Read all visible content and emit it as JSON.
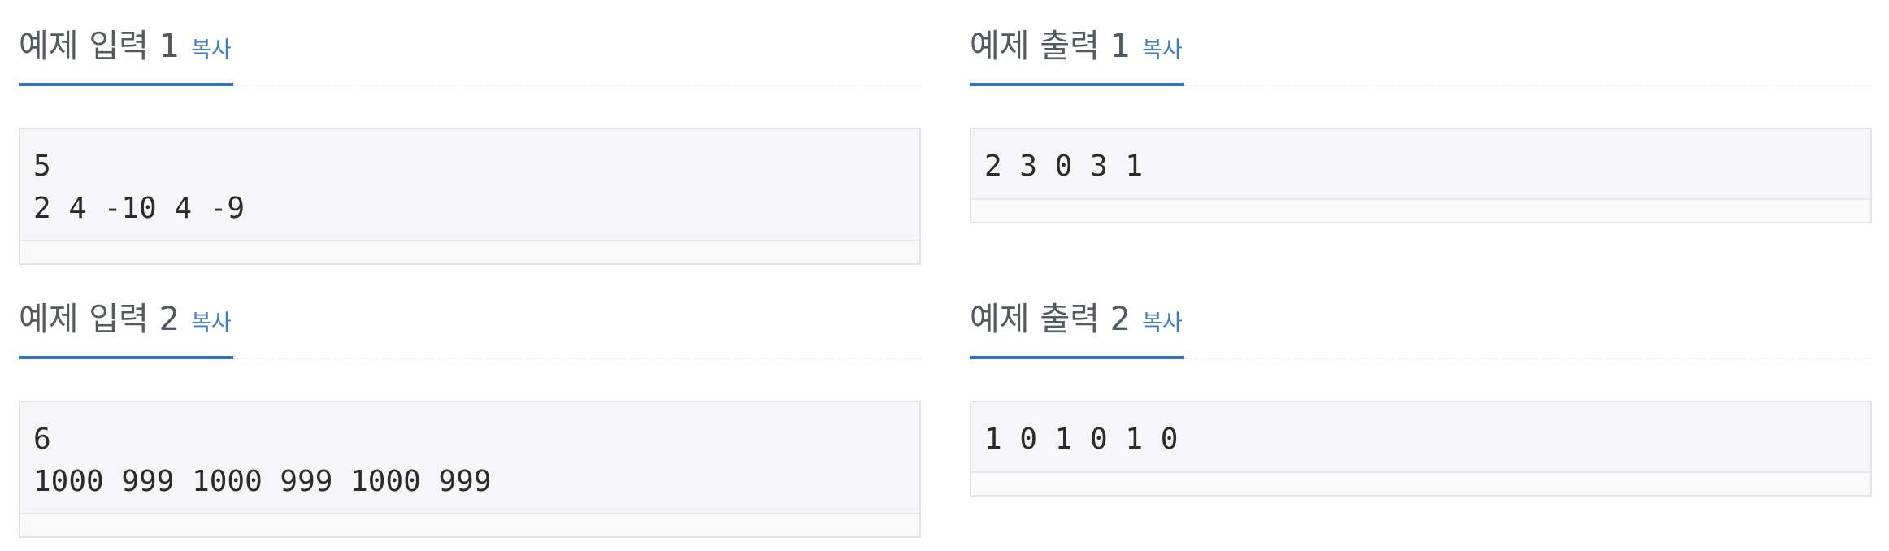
{
  "samples": [
    {
      "title": "예제 입력 1",
      "copy_label": "복사",
      "content": "5\n2 4 -10 4 -9"
    },
    {
      "title": "예제 출력 1",
      "copy_label": "복사",
      "content": "2 3 0 3 1"
    },
    {
      "title": "예제 입력 2",
      "copy_label": "복사",
      "content": "6\n1000 999 1000 999 1000 999"
    },
    {
      "title": "예제 출력 2",
      "copy_label": "복사",
      "content": "1 0 1 0 1 0"
    }
  ],
  "colors": {
    "title": "#555a62",
    "copy_link": "#3d7fc6",
    "accent_underline": "#2c74c2",
    "sample_background": "#f6f6f8",
    "sample_border": "#e2e4e8"
  }
}
